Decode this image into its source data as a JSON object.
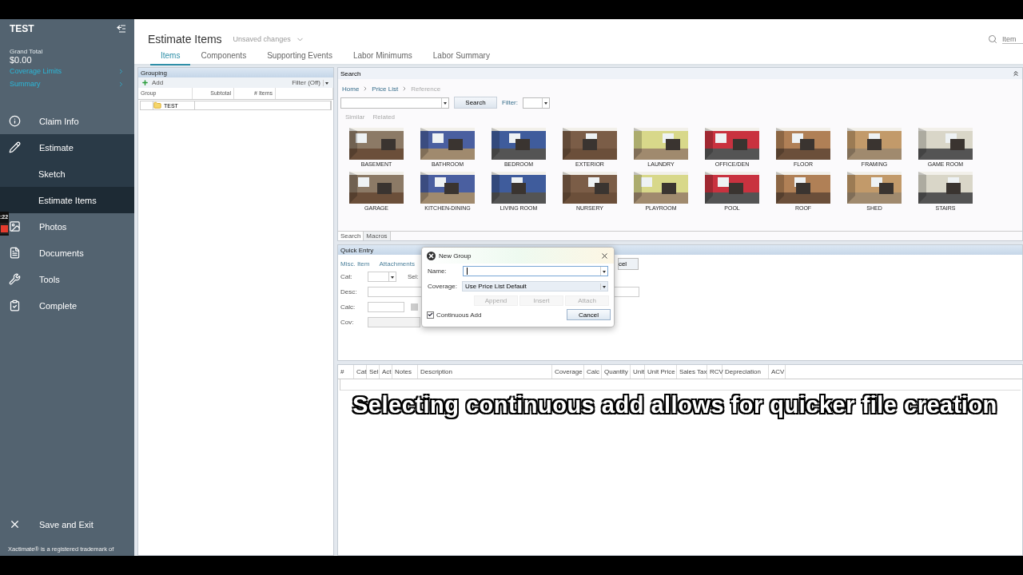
{
  "sidebar": {
    "title": "TEST",
    "grand_total_label": "Grand Total",
    "grand_total": "$0.00",
    "links": [
      "Coverage Limits",
      "Summary"
    ],
    "nav": [
      {
        "label": "Claim Info",
        "selected": false
      },
      {
        "label": "Estimate",
        "selected": false,
        "expanded": true,
        "children": [
          {
            "label": "Sketch",
            "selected": false
          },
          {
            "label": "Estimate Items",
            "selected": true
          }
        ]
      },
      {
        "label": "Photos",
        "selected": false
      },
      {
        "label": "Documents",
        "selected": false
      },
      {
        "label": "Tools",
        "selected": false
      },
      {
        "label": "Complete",
        "selected": false
      }
    ],
    "save_exit": "Save and Exit",
    "trademark": "Xactimate® is a registered trademark of"
  },
  "recorder": {
    "time": ":22"
  },
  "header": {
    "title": "Estimate Items",
    "status": "Unsaved changes",
    "search_placeholder": "Item"
  },
  "tabs": [
    {
      "label": "Items",
      "selected": true
    },
    {
      "label": "Components",
      "selected": false
    },
    {
      "label": "Supporting Events",
      "selected": false
    },
    {
      "label": "Labor Minimums",
      "selected": false
    },
    {
      "label": "Labor Summary",
      "selected": false
    }
  ],
  "grouping": {
    "title": "Grouping",
    "add": "Add",
    "filter": "Filter (Off)",
    "columns": [
      "Group",
      "Subtotal",
      "# Items"
    ],
    "rows": [
      {
        "group": "TEST"
      }
    ]
  },
  "search": {
    "title": "Search",
    "breadcrumb": [
      "Home",
      "Price List",
      "Reference"
    ],
    "search_button": "Search",
    "filter_label": "Filter:",
    "links": [
      "Similar",
      "Related"
    ],
    "categories": [
      "BASEMENT",
      "BATHROOM",
      "BEDROOM",
      "EXTERIOR",
      "LAUNDRY",
      "OFFICE/DEN",
      "FLOOR",
      "FRAMING",
      "GAME ROOM",
      "GARAGE",
      "KITCHEN-DINING",
      "LIVING ROOM",
      "NURSERY",
      "PLAYROOM",
      "POOL",
      "ROOF",
      "SHED",
      "STAIRS"
    ],
    "bottom_tabs": [
      {
        "label": "Search",
        "selected": true
      },
      {
        "label": "Macros",
        "selected": false
      }
    ]
  },
  "quick_entry": {
    "title": "Quick Entry",
    "links": [
      "Misc. Item",
      "Attachments"
    ],
    "button_fragment": "cel",
    "cat": "Cat:",
    "sel": "Sel:",
    "desc": "Desc:",
    "calc": "Calc:",
    "cov": "Cov:"
  },
  "table": {
    "columns": [
      "#",
      "Cat",
      "Sel",
      "Act",
      "Notes",
      "Description",
      "Coverage",
      "Calc",
      "Quantity",
      "Unit",
      "Unit Price",
      "Sales Tax",
      "RCV",
      "Depreciation",
      "ACV"
    ]
  },
  "dialog": {
    "title": "New Group",
    "name_label": "Name:",
    "coverage_label": "Coverage:",
    "coverage_value": "Use Price List Default",
    "buttons": [
      {
        "label": "Append",
        "disabled": true
      },
      {
        "label": "Insert",
        "disabled": true
      },
      {
        "label": "Attach",
        "disabled": true
      }
    ],
    "continuous_add": {
      "label": "Continuous Add",
      "checked": true
    },
    "cancel": "Cancel"
  },
  "caption": "Selecting continuous add allows for quicker file creation"
}
